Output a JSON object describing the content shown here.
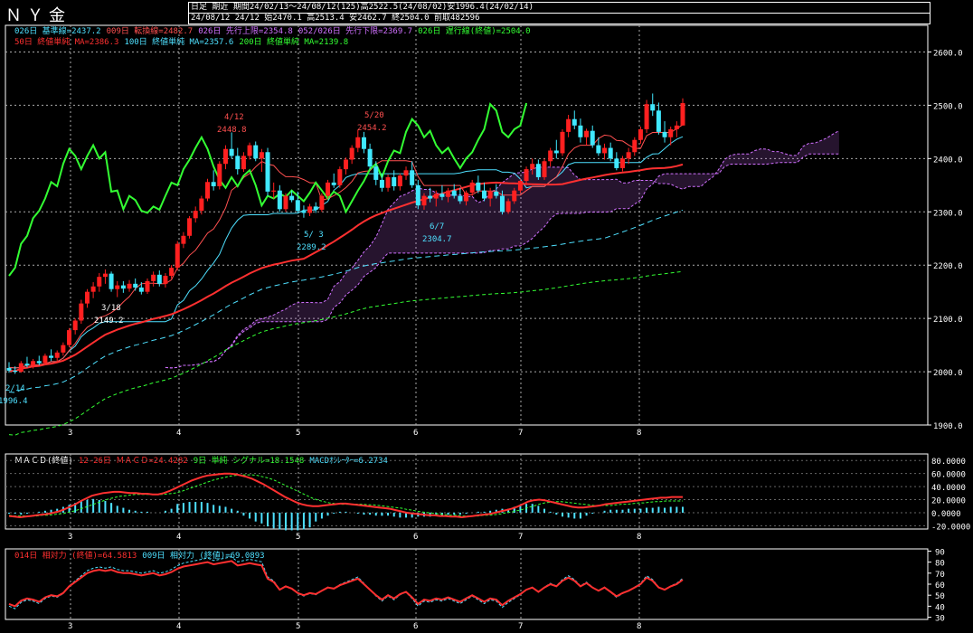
{
  "header": {
    "title": "ＮＹ金",
    "line1": "日足 期近 期間24/02/13～24/08/12(125)高2522.5(24/08/02)安1996.4(24/02/14)",
    "line2": "24/08/12 24/12 始2470.1 高2513.4 安2462.7 終2504.0 前取482596"
  },
  "legend_rows": [
    [
      {
        "text": "026日 基準線=2437.2",
        "color": "#4ee0ff"
      },
      {
        "text": "009日 転換線=2482.7",
        "color": "#ff5050"
      },
      {
        "text": "026日 先行上限=2354.8",
        "color": "#d070ff"
      },
      {
        "text": "052/026日 先行下限=2369.7",
        "color": "#d070ff"
      },
      {
        "text": "026日 遅行線(終値)=2504.0",
        "color": "#33ff33"
      }
    ],
    [
      {
        "text": "50日 終値単純 MA=2386.3",
        "color": "#ff3030"
      },
      {
        "text": "100日 終値単純 MA=2357.6",
        "color": "#4ee0ff"
      },
      {
        "text": "200日 終値単純 MA=2139.8",
        "color": "#33ff33"
      }
    ]
  ],
  "annotations": [
    {
      "text": "4/12",
      "value": "2448.8",
      "color": "#ff5050"
    },
    {
      "text": "5/20",
      "value": "2454.2",
      "color": "#ff5050"
    },
    {
      "text": "3/18",
      "value": "2149.2",
      "color": "#ffffff"
    },
    {
      "text": "5/ 3",
      "value": "2289.2",
      "color": "#4ee0ff"
    },
    {
      "text": "6/7",
      "value": "2304.7",
      "color": "#4ee0ff"
    },
    {
      "text": "2/14",
      "value": "1996.4",
      "color": "#4ee0ff"
    }
  ],
  "price_axis": [
    "2600.0",
    "2500.0",
    "2400.0",
    "2300.0",
    "2200.0",
    "2100.0",
    "2000.0",
    "1900.0"
  ],
  "macd_legend": [
    {
      "text": "ＭＡＣＤ(終値)",
      "color": "#ffffff"
    },
    {
      "text": "12-26日 ＭＡＣＤ=24.4282",
      "color": "#ff3030"
    },
    {
      "text": "9日 単純 シグナル=18.1548",
      "color": "#33ff33"
    },
    {
      "text": "MACDｵｼﾚｰﾀｰ=6.2734",
      "color": "#4ee0ff"
    }
  ],
  "macd_axis": [
    "80.0000",
    "60.0000",
    "40.0000",
    "20.0000",
    "0.0000",
    "-20.0000"
  ],
  "rsi_legend": [
    {
      "text": "014日 相対力 (終値)=64.5813",
      "color": "#ff3030"
    },
    {
      "text": "009日 相対力 (終値)=69.0893",
      "color": "#4ee0ff"
    }
  ],
  "rsi_axis": [
    "90",
    "80",
    "70",
    "60",
    "50",
    "40",
    "30"
  ],
  "x_months": [
    "3",
    "4",
    "5",
    "6",
    "7",
    "8"
  ],
  "colors": {
    "bull": "#ff2020",
    "bear": "#40e8ff",
    "tenkan": "#ff5050",
    "kijun": "#4ee0ff",
    "span": "#d070ff",
    "chikou": "#33ff33",
    "ma50": "#ff3030",
    "ma100": "#4ee0ff",
    "ma200": "#33ff33"
  },
  "chart_data": {
    "type": "candlestick",
    "ylim": [
      1900,
      2650
    ],
    "grid": true,
    "start": "2024-02-13",
    "end": "2024-08-12",
    "candles": [
      [
        2007,
        2018,
        1998,
        2002
      ],
      [
        2002,
        2010,
        1996,
        2000
      ],
      [
        2000,
        2020,
        1998,
        2016
      ],
      [
        2015,
        2028,
        2008,
        2012
      ],
      [
        2012,
        2024,
        2006,
        2020
      ],
      [
        2020,
        2030,
        2012,
        2016
      ],
      [
        2016,
        2034,
        2012,
        2030
      ],
      [
        2030,
        2042,
        2020,
        2026
      ],
      [
        2026,
        2040,
        2018,
        2036
      ],
      [
        2036,
        2055,
        2030,
        2050
      ],
      [
        2050,
        2082,
        2046,
        2078
      ],
      [
        2078,
        2100,
        2070,
        2096
      ],
      [
        2096,
        2135,
        2090,
        2128
      ],
      [
        2128,
        2155,
        2120,
        2150
      ],
      [
        2150,
        2168,
        2138,
        2160
      ],
      [
        2160,
        2185,
        2150,
        2178
      ],
      [
        2178,
        2192,
        2165,
        2184
      ],
      [
        2184,
        2188,
        2150,
        2155
      ],
      [
        2155,
        2170,
        2140,
        2162
      ],
      [
        2162,
        2170,
        2148,
        2156
      ],
      [
        2156,
        2172,
        2150,
        2165
      ],
      [
        2165,
        2175,
        2152,
        2158
      ],
      [
        2158,
        2168,
        2145,
        2150
      ],
      [
        2150,
        2175,
        2146,
        2170
      ],
      [
        2170,
        2188,
        2160,
        2182
      ],
      [
        2182,
        2190,
        2160,
        2165
      ],
      [
        2165,
        2185,
        2158,
        2180
      ],
      [
        2180,
        2200,
        2175,
        2195
      ],
      [
        2195,
        2245,
        2190,
        2240
      ],
      [
        2240,
        2262,
        2232,
        2255
      ],
      [
        2255,
        2292,
        2250,
        2288
      ],
      [
        2288,
        2310,
        2280,
        2302
      ],
      [
        2302,
        2330,
        2295,
        2325
      ],
      [
        2325,
        2362,
        2320,
        2356
      ],
      [
        2356,
        2378,
        2340,
        2348
      ],
      [
        2348,
        2395,
        2342,
        2390
      ],
      [
        2390,
        2425,
        2380,
        2418
      ],
      [
        2418,
        2449,
        2400,
        2405
      ],
      [
        2405,
        2420,
        2370,
        2380
      ],
      [
        2380,
        2412,
        2375,
        2405
      ],
      [
        2405,
        2430,
        2398,
        2425
      ],
      [
        2425,
        2432,
        2395,
        2400
      ],
      [
        2400,
        2418,
        2375,
        2412
      ],
      [
        2412,
        2420,
        2330,
        2338
      ],
      [
        2338,
        2355,
        2325,
        2340
      ],
      [
        2340,
        2350,
        2300,
        2305
      ],
      [
        2305,
        2335,
        2300,
        2330
      ],
      [
        2330,
        2340,
        2318,
        2322
      ],
      [
        2322,
        2338,
        2298,
        2302
      ],
      [
        2302,
        2312,
        2289,
        2298
      ],
      [
        2298,
        2315,
        2292,
        2310
      ],
      [
        2310,
        2318,
        2298,
        2304
      ],
      [
        2304,
        2335,
        2300,
        2330
      ],
      [
        2330,
        2360,
        2325,
        2355
      ],
      [
        2355,
        2372,
        2345,
        2350
      ],
      [
        2350,
        2385,
        2345,
        2380
      ],
      [
        2380,
        2402,
        2370,
        2398
      ],
      [
        2398,
        2425,
        2390,
        2420
      ],
      [
        2420,
        2454,
        2412,
        2440
      ],
      [
        2440,
        2450,
        2410,
        2418
      ],
      [
        2418,
        2428,
        2380,
        2385
      ],
      [
        2385,
        2395,
        2350,
        2360
      ],
      [
        2360,
        2372,
        2338,
        2345
      ],
      [
        2345,
        2370,
        2338,
        2365
      ],
      [
        2365,
        2378,
        2340,
        2348
      ],
      [
        2348,
        2372,
        2340,
        2368
      ],
      [
        2368,
        2385,
        2360,
        2378
      ],
      [
        2378,
        2395,
        2345,
        2350
      ],
      [
        2350,
        2360,
        2305,
        2312
      ],
      [
        2312,
        2335,
        2304,
        2330
      ],
      [
        2330,
        2345,
        2318,
        2325
      ],
      [
        2325,
        2340,
        2310,
        2334
      ],
      [
        2334,
        2350,
        2322,
        2328
      ],
      [
        2328,
        2345,
        2318,
        2340
      ],
      [
        2340,
        2352,
        2325,
        2330
      ],
      [
        2330,
        2345,
        2315,
        2320
      ],
      [
        2320,
        2340,
        2312,
        2336
      ],
      [
        2336,
        2360,
        2330,
        2355
      ],
      [
        2355,
        2368,
        2335,
        2340
      ],
      [
        2340,
        2355,
        2320,
        2325
      ],
      [
        2325,
        2345,
        2310,
        2338
      ],
      [
        2338,
        2352,
        2325,
        2330
      ],
      [
        2330,
        2340,
        2295,
        2300
      ],
      [
        2300,
        2325,
        2296,
        2320
      ],
      [
        2320,
        2345,
        2315,
        2340
      ],
      [
        2340,
        2362,
        2335,
        2358
      ],
      [
        2358,
        2385,
        2350,
        2380
      ],
      [
        2380,
        2400,
        2370,
        2390
      ],
      [
        2390,
        2398,
        2360,
        2365
      ],
      [
        2365,
        2400,
        2360,
        2395
      ],
      [
        2395,
        2420,
        2385,
        2415
      ],
      [
        2415,
        2435,
        2400,
        2410
      ],
      [
        2410,
        2455,
        2405,
        2450
      ],
      [
        2450,
        2482,
        2440,
        2474
      ],
      [
        2474,
        2490,
        2455,
        2462
      ],
      [
        2462,
        2475,
        2430,
        2440
      ],
      [
        2440,
        2456,
        2425,
        2452
      ],
      [
        2452,
        2462,
        2420,
        2425
      ],
      [
        2425,
        2440,
        2405,
        2410
      ],
      [
        2410,
        2428,
        2398,
        2420
      ],
      [
        2420,
        2430,
        2395,
        2400
      ],
      [
        2400,
        2412,
        2378,
        2382
      ],
      [
        2382,
        2405,
        2376,
        2400
      ],
      [
        2400,
        2420,
        2390,
        2412
      ],
      [
        2412,
        2440,
        2405,
        2435
      ],
      [
        2435,
        2460,
        2428,
        2455
      ],
      [
        2455,
        2510,
        2448,
        2502
      ],
      [
        2502,
        2522,
        2480,
        2490
      ],
      [
        2490,
        2505,
        2445,
        2450
      ],
      [
        2450,
        2470,
        2430,
        2440
      ],
      [
        2440,
        2460,
        2425,
        2455
      ],
      [
        2455,
        2470,
        2440,
        2462
      ],
      [
        2462,
        2513,
        2462,
        2504
      ]
    ],
    "macd": [
      -5,
      -6,
      -7,
      -6,
      -5,
      -4,
      -3,
      -2,
      0,
      2,
      5,
      9,
      13,
      18,
      22,
      26,
      28,
      30,
      31,
      32,
      32,
      31,
      30,
      30,
      29,
      29,
      28,
      28,
      30,
      33,
      37,
      41,
      45,
      49,
      52,
      55,
      57,
      58,
      59,
      60,
      60,
      59,
      57,
      55,
      52,
      48,
      44,
      39,
      34,
      29,
      24,
      20,
      16,
      13,
      11,
      10,
      10,
      11,
      12,
      13,
      14,
      14,
      13,
      12,
      11,
      10,
      9,
      8,
      7,
      6,
      4,
      2,
      0,
      -1,
      -2,
      -3,
      -4,
      -4,
      -5,
      -5,
      -6,
      -6,
      -7,
      -6,
      -5,
      -4,
      -3,
      -2,
      0,
      2,
      4,
      6,
      9,
      13,
      17,
      19,
      20,
      19,
      17,
      15,
      13,
      11,
      9,
      8,
      8,
      9,
      10,
      11,
      13,
      14,
      15,
      16,
      17,
      18,
      19,
      20,
      21,
      22,
      23,
      23,
      24,
      24,
      24
    ],
    "signal": [
      -4,
      -5,
      -5,
      -5,
      -5,
      -5,
      -4,
      -4,
      -3,
      -2,
      -1,
      1,
      3,
      6,
      9,
      12,
      15,
      18,
      21,
      23,
      25,
      26,
      27,
      28,
      28,
      28,
      28,
      28,
      28,
      29,
      30,
      32,
      35,
      38,
      41,
      44,
      47,
      50,
      52,
      54,
      56,
      57,
      58,
      58,
      58,
      57,
      55,
      53,
      50,
      46,
      42,
      38,
      34,
      30,
      26,
      22,
      19,
      17,
      15,
      14,
      13,
      13,
      13,
      13,
      13,
      12,
      12,
      11,
      10,
      9,
      8,
      7,
      5,
      4,
      2,
      1,
      0,
      -1,
      -2,
      -3,
      -4,
      -4,
      -5,
      -5,
      -5,
      -5,
      -4,
      -4,
      -3,
      -2,
      0,
      1,
      3,
      5,
      8,
      10,
      13,
      15,
      16,
      17,
      17,
      16,
      15,
      14,
      13,
      12,
      11,
      11,
      11,
      11,
      12,
      13,
      13,
      14,
      15,
      15,
      16,
      17,
      17,
      18,
      18,
      18,
      18
    ],
    "rsi14": [
      42,
      40,
      45,
      47,
      46,
      44,
      48,
      50,
      49,
      52,
      58,
      62,
      66,
      70,
      72,
      73,
      72,
      73,
      71,
      70,
      70,
      69,
      68,
      69,
      70,
      68,
      69,
      71,
      74,
      76,
      77,
      78,
      79,
      80,
      78,
      79,
      80,
      81,
      77,
      78,
      79,
      78,
      77,
      65,
      62,
      55,
      58,
      56,
      52,
      50,
      52,
      51,
      54,
      57,
      56,
      59,
      61,
      63,
      65,
      60,
      55,
      50,
      46,
      50,
      47,
      51,
      53,
      48,
      42,
      46,
      45,
      47,
      46,
      48,
      46,
      44,
      47,
      50,
      47,
      44,
      47,
      46,
      41,
      45,
      48,
      51,
      55,
      57,
      53,
      57,
      60,
      58,
      63,
      66,
      63,
      58,
      61,
      57,
      54,
      57,
      53,
      49,
      52,
      54,
      57,
      60,
      66,
      63,
      57,
      55,
      58,
      60,
      64
    ]
  }
}
